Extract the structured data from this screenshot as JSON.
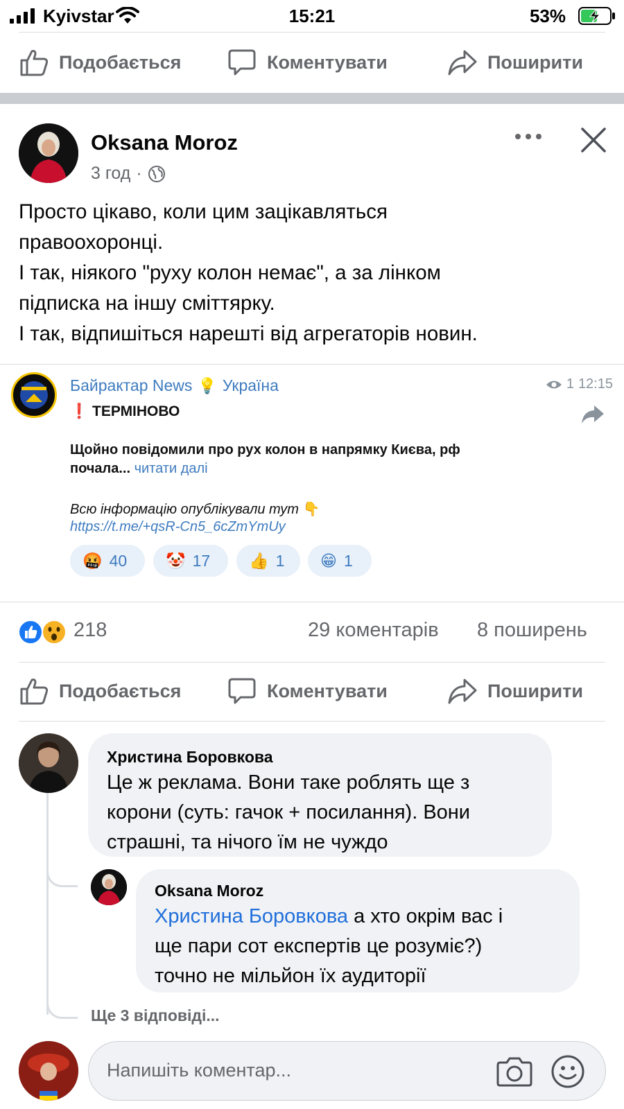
{
  "status_bar": {
    "carrier": "Kyivstar",
    "time": "15:21",
    "battery": "53%"
  },
  "actions": {
    "like": "Подобається",
    "comment": "Коментувати",
    "share": "Поширити"
  },
  "post": {
    "author": "Oksana Moroz",
    "time": "3 год",
    "text_lines": [
      "Просто цікаво, коли цим зацікавляться",
      "правоохоронці.",
      "І так, ніякого \"руху колон немає\", а за лінком",
      "підписка на іншу сміттярку.",
      "І так, відпишіться нарешті від агрегаторів новин."
    ],
    "embed": {
      "channel": "Байрактар News",
      "channel_emoji": "💡",
      "channel_suffix": "Україна",
      "views": "1",
      "time": "12:15",
      "urgent": "ТЕРМІНОВО",
      "line1": "Щойно повідомили про рух колон в напрямку Києва,  рф",
      "line2": "почала...",
      "read_more": "читати далі",
      "info": "Всю інформацію опублікували тут",
      "link": "https://t.me/+qsR-Cn5_6cZmYmUy",
      "reactions": [
        {
          "emoji": "🤬",
          "count": "40"
        },
        {
          "emoji": "🤡",
          "count": "17"
        },
        {
          "emoji": "👍",
          "count": "1"
        },
        {
          "emoji": "😁",
          "count": "1"
        }
      ]
    },
    "reaction_count": "218",
    "comments_count": "29 коментарів",
    "shares_count": "8 поширень"
  },
  "comments": [
    {
      "author": "Христина Боровкова",
      "lines": [
        "Це ж реклама. Вони таке роблять ще з",
        "корони (суть: гачок + посилання). Вони",
        "страшні, та нічого їм не чуждо"
      ]
    }
  ],
  "reply": {
    "author": "Oksana Moroz",
    "mention": "Христина Боровкова",
    "line1_rest": " а хто окрім вас і",
    "lines": [
      "ще пари сот експертів це розуміє?)",
      "точно не мільйон їх аудиторії"
    ]
  },
  "more_replies": "Ще 3 відповіді...",
  "comment_input": {
    "placeholder": "Напишіть коментар..."
  },
  "colors": {
    "facebook_blue": "#1877f2",
    "gray_text": "#65676b",
    "telegram_link": "#3e7bbf"
  }
}
